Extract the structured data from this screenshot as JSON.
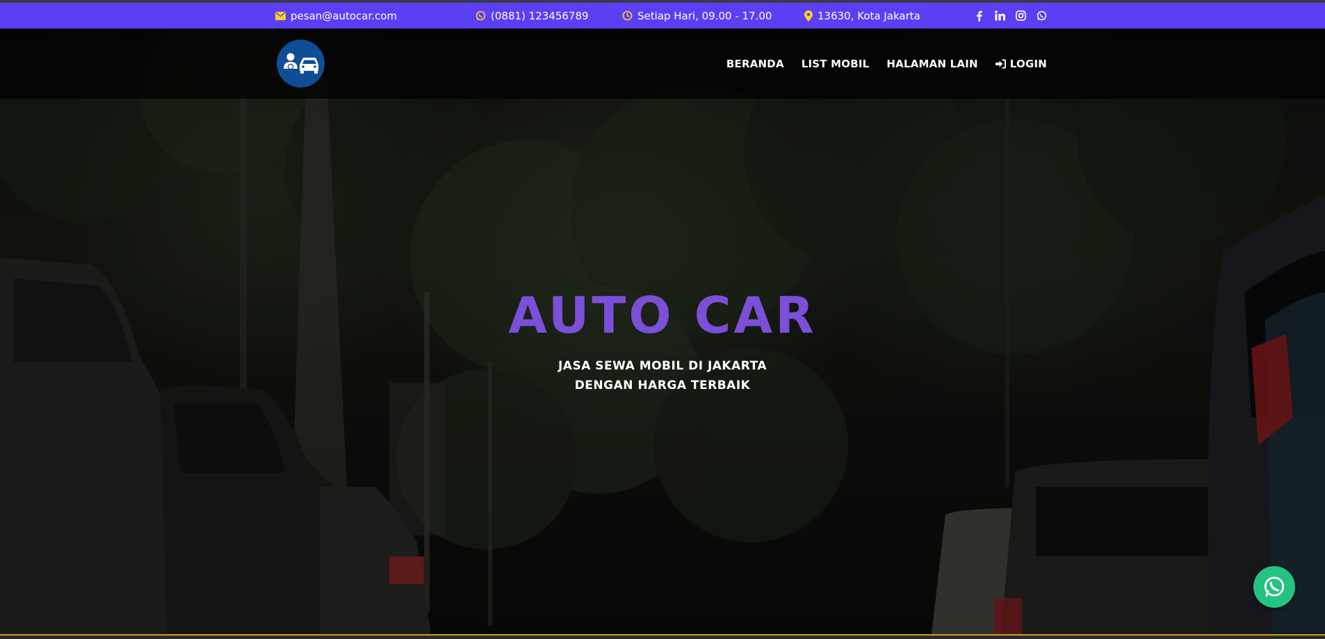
{
  "topbar": {
    "email": "pesan@autocar.com",
    "phone": "(0881) 123456789",
    "hours": "Setiap Hari, 09.00 - 17.00",
    "location": "13630, Kota Jakarta",
    "icons": {
      "email": "envelope-icon",
      "phone": "whatsapp-icon",
      "hours": "clock-icon",
      "location": "map-pin-icon"
    },
    "social": [
      "facebook-icon",
      "linkedin-icon",
      "instagram-icon",
      "whatsapp-icon"
    ]
  },
  "nav": {
    "items": [
      {
        "label": "BERANDA"
      },
      {
        "label": "LIST MOBIL"
      },
      {
        "label": "HALAMAN LAIN"
      },
      {
        "label": "LOGIN",
        "icon": "sign-in-icon"
      }
    ]
  },
  "hero": {
    "title": "AUTO CAR",
    "subtitle_line1": "JASA SEWA MOBIL DI JAKARTA",
    "subtitle_line2": "DENGAN HARGA TERBAIK"
  },
  "colors": {
    "topbar": "#5b3ff5",
    "accent_icon": "#ffd21f",
    "title": "#7b4fd8",
    "logo_bg": "#0f4d96",
    "whatsapp": "#25c281"
  }
}
